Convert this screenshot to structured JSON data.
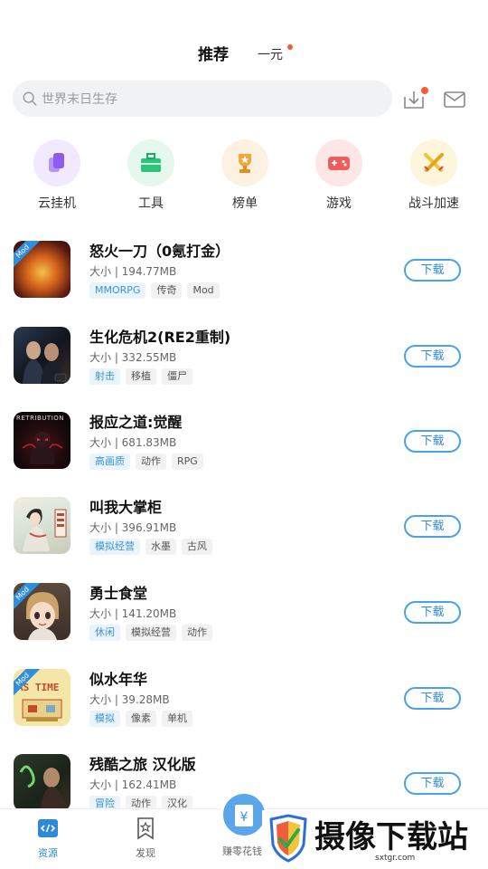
{
  "header": {
    "tab_main": "推荐",
    "tab_second": "一元"
  },
  "search": {
    "placeholder": "世界末日生存"
  },
  "categories": [
    {
      "label": "云挂机",
      "icon": "phone-icon",
      "color": "#9b6cf0"
    },
    {
      "label": "工具",
      "icon": "toolbox-icon",
      "color": "#2fc47a"
    },
    {
      "label": "榜单",
      "icon": "trophy-icon",
      "color": "#f2a73a"
    },
    {
      "label": "游戏",
      "icon": "gamepad-icon",
      "color": "#f25c5c"
    },
    {
      "label": "战斗加速",
      "icon": "swords-icon",
      "color": "#f2c43a"
    }
  ],
  "games": [
    {
      "title": "怒火一刀（0氪打金）",
      "size": "大小 | 194.77MB",
      "tags": [
        "MMORPG",
        "传奇",
        "Mod"
      ],
      "mod": true,
      "button": "下载"
    },
    {
      "title": "生化危机2(RE2重制)",
      "size": "大小 | 332.55MB",
      "tags": [
        "射击",
        "移植",
        "僵尸"
      ],
      "mod": false,
      "button": "下载"
    },
    {
      "title": "报应之道:觉醒",
      "size": "大小 | 681.83MB",
      "tags": [
        "高画质",
        "动作",
        "RPG"
      ],
      "mod": false,
      "button": "下载",
      "thumb_text": "RETRIBUTION"
    },
    {
      "title": "叫我大掌柜",
      "size": "大小 | 396.91MB",
      "tags": [
        "模拟经营",
        "水墨",
        "古风"
      ],
      "mod": false,
      "button": "下载"
    },
    {
      "title": "勇士食堂",
      "size": "大小 | 141.20MB",
      "tags": [
        "休闲",
        "模拟经营",
        "动作"
      ],
      "mod": true,
      "button": "下载"
    },
    {
      "title": "似水年华",
      "size": "大小 | 39.28MB",
      "tags": [
        "模拟",
        "像素",
        "单机"
      ],
      "mod": true,
      "button": "下载",
      "thumb_text": "AS TIME"
    },
    {
      "title": "残酷之旅  汉化版",
      "size": "大小 | 162.41MB",
      "tags": [
        "冒险",
        "动作",
        "汉化"
      ],
      "mod": false,
      "button": "下载"
    }
  ],
  "mod_badge": "Mod",
  "bottom_nav": {
    "resources": "资源",
    "discover": "发现",
    "earn": "赚零花钱"
  },
  "watermark": {
    "text": "摄像下载站",
    "url": "sxtgr.com"
  },
  "colors": {
    "accent": "#2d8ad8",
    "dot": "#f25c3b"
  }
}
